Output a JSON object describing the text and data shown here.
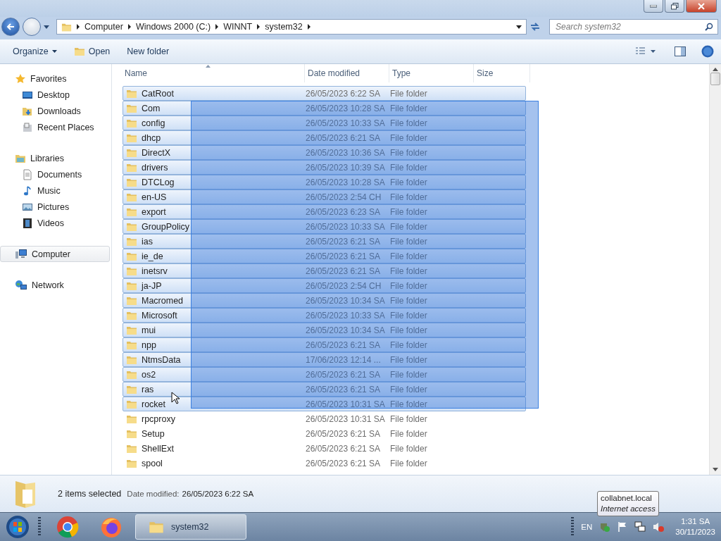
{
  "address": {
    "crumbs": [
      "Computer",
      "Windows 2000 (C:)",
      "WINNT",
      "system32"
    ],
    "search_placeholder": "Search system32"
  },
  "toolbar": [
    {
      "kind": "menu",
      "label": "Organize"
    },
    {
      "kind": "open",
      "label": "Open"
    },
    {
      "kind": "plain",
      "label": "New folder"
    }
  ],
  "sidebar": [
    {
      "kind": "favorites",
      "label": "Favorites",
      "selected": false,
      "children": [
        {
          "kind": "desktop",
          "label": "Desktop",
          "selected": false
        },
        {
          "kind": "downloads",
          "label": "Downloads",
          "selected": false
        },
        {
          "kind": "recent",
          "label": "Recent Places",
          "selected": false
        }
      ]
    },
    {
      "kind": "libraries",
      "label": "Libraries",
      "selected": false,
      "children": [
        {
          "kind": "documents",
          "label": "Documents",
          "selected": false
        },
        {
          "kind": "music",
          "label": "Music",
          "selected": false
        },
        {
          "kind": "pictures",
          "label": "Pictures",
          "selected": false
        },
        {
          "kind": "videos",
          "label": "Videos",
          "selected": false
        }
      ]
    },
    {
      "kind": "computer",
      "label": "Computer",
      "selected": true
    },
    {
      "kind": "network",
      "label": "Network",
      "selected": false
    }
  ],
  "columns": [
    {
      "label": "Name",
      "sorted": true
    },
    {
      "label": "Date modified",
      "sorted": false
    },
    {
      "label": "Type",
      "sorted": false
    },
    {
      "label": "Size",
      "sorted": false
    }
  ],
  "rows": [
    {
      "name": "CatRoot",
      "date": "26/05/2023 6:22 SA",
      "type": "File folder",
      "selected": true
    },
    {
      "name": "Com",
      "date": "26/05/2023 10:28 SA",
      "type": "File folder",
      "selected": true
    },
    {
      "name": "config",
      "date": "26/05/2023 10:33 SA",
      "type": "File folder",
      "selected": true
    },
    {
      "name": "dhcp",
      "date": "26/05/2023 6:21 SA",
      "type": "File folder",
      "selected": true
    },
    {
      "name": "DirectX",
      "date": "26/05/2023 10:36 SA",
      "type": "File folder",
      "selected": true
    },
    {
      "name": "drivers",
      "date": "26/05/2023 10:39 SA",
      "type": "File folder",
      "selected": true
    },
    {
      "name": "DTCLog",
      "date": "26/05/2023 10:28 SA",
      "type": "File folder",
      "selected": true
    },
    {
      "name": "en-US",
      "date": "26/05/2023 2:54 CH",
      "type": "File folder",
      "selected": true
    },
    {
      "name": "export",
      "date": "26/05/2023 6:23 SA",
      "type": "File folder",
      "selected": true
    },
    {
      "name": "GroupPolicy",
      "date": "26/05/2023 10:33 SA",
      "type": "File folder",
      "selected": true
    },
    {
      "name": "ias",
      "date": "26/05/2023 6:21 SA",
      "type": "File folder",
      "selected": true
    },
    {
      "name": "ie_de",
      "date": "26/05/2023 6:21 SA",
      "type": "File folder",
      "selected": true
    },
    {
      "name": "inetsrv",
      "date": "26/05/2023 6:21 SA",
      "type": "File folder",
      "selected": true
    },
    {
      "name": "ja-JP",
      "date": "26/05/2023 2:54 CH",
      "type": "File folder",
      "selected": true
    },
    {
      "name": "Macromed",
      "date": "26/05/2023 10:34 SA",
      "type": "File folder",
      "selected": true
    },
    {
      "name": "Microsoft",
      "date": "26/05/2023 10:33 SA",
      "type": "File folder",
      "selected": true
    },
    {
      "name": "mui",
      "date": "26/05/2023 10:34 SA",
      "type": "File folder",
      "selected": true
    },
    {
      "name": "npp",
      "date": "26/05/2023 6:21 SA",
      "type": "File folder",
      "selected": true
    },
    {
      "name": "NtmsData",
      "date": "17/06/2023 12:14 ...",
      "type": "File folder",
      "selected": true
    },
    {
      "name": "os2",
      "date": "26/05/2023 6:21 SA",
      "type": "File folder",
      "selected": true
    },
    {
      "name": "ras",
      "date": "26/05/2023 6:21 SA",
      "type": "File folder",
      "selected": true
    },
    {
      "name": "rocket",
      "date": "26/05/2023 10:31 SA",
      "type": "File folder",
      "selected": true
    },
    {
      "name": "rpcproxy",
      "date": "26/05/2023 10:31 SA",
      "type": "File folder",
      "selected": false
    },
    {
      "name": "Setup",
      "date": "26/05/2023 6:21 SA",
      "type": "File folder",
      "selected": false
    },
    {
      "name": "ShellExt",
      "date": "26/05/2023 6:21 SA",
      "type": "File folder",
      "selected": false
    },
    {
      "name": "spool",
      "date": "26/05/2023 6:21 SA",
      "type": "File folder",
      "selected": false
    }
  ],
  "status": {
    "count": "2 items selected",
    "date_label": "Date modified:",
    "date_value": "26/05/2023 6:22 SA"
  },
  "taskbar": {
    "window": "system32",
    "language": "EN",
    "time": "1:31 SA",
    "date": "30/11/2023"
  },
  "tooltip": {
    "title": "collabnet.local",
    "subtitle": "Internet access"
  }
}
